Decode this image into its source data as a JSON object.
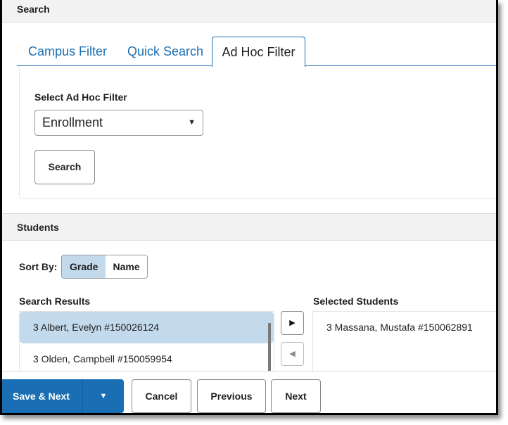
{
  "search_section": {
    "title": "Search",
    "tabs": [
      {
        "label": "Campus Filter",
        "active": false
      },
      {
        "label": "Quick Search",
        "active": false
      },
      {
        "label": "Ad Hoc Filter",
        "active": true
      }
    ],
    "filter_label": "Select Ad Hoc Filter",
    "filter_value": "Enrollment",
    "search_button": "Search"
  },
  "students_section": {
    "title": "Students",
    "sort_by_label": "Sort By:",
    "sort_options": [
      {
        "label": "Grade",
        "active": true
      },
      {
        "label": "Name",
        "active": false
      }
    ],
    "search_results_title": "Search Results",
    "search_results": [
      {
        "label": "3 Albert, Evelyn #150026124",
        "highlighted": true
      },
      {
        "label": "3 Olden, Campbell #150059954",
        "highlighted": false
      }
    ],
    "selected_students_title": "Selected Students",
    "selected_students": [
      {
        "label": "3 Massana, Mustafa #150062891"
      }
    ],
    "add_icon": "triangle-right",
    "remove_icon": "triangle-left"
  },
  "footer": {
    "save_next": "Save & Next",
    "save_dropdown_icon": "caret-down",
    "cancel": "Cancel",
    "previous": "Previous",
    "next": "Next"
  },
  "colors": {
    "accent": "#1a6fb4",
    "highlight": "#c3d9ec",
    "header_bg": "#f2f2f2"
  }
}
